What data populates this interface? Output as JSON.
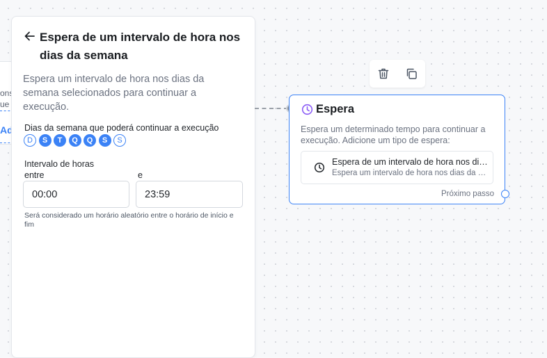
{
  "left_node": {
    "fragment_1": "ons",
    "fragment_2": "ue",
    "fragment_3": "Ad"
  },
  "panel": {
    "title": "Espera de um intervalo de hora nos dias da semana",
    "description": "Espera um intervalo de hora nos dias da semana selecionados para continuar a execução.",
    "days_label": "Dias da semana que poderá continuar a execução",
    "days": [
      {
        "label": "D",
        "selected": false
      },
      {
        "label": "S",
        "selected": true
      },
      {
        "label": "T",
        "selected": true
      },
      {
        "label": "Q",
        "selected": true
      },
      {
        "label": "Q",
        "selected": true
      },
      {
        "label": "S",
        "selected": true
      },
      {
        "label": "S",
        "selected": false
      }
    ],
    "hours_label": "Intervalo de horas",
    "from_label": "entre",
    "to_label": "e",
    "from_value": "00:00",
    "to_value": "23:59",
    "hint": "Será considerado um horário aleatório entre o horário de início e fim"
  },
  "node": {
    "title": "Espera",
    "description": "Espera um determinado tempo para continuar a execução. Adicione um tipo de espera:",
    "wait_item_title": "Espera de um intervalo de hora nos dias da semana",
    "wait_item_subtitle": "Espera um intervalo de hora nos dias da semana selecionados",
    "next_step_label": "Próximo passo"
  },
  "colors": {
    "accent": "#3b82f6",
    "node_icon": "#8b5cf6",
    "muted_text": "#6b7280"
  },
  "icons": {
    "back": "arrow-left-icon",
    "delete": "trash-icon",
    "duplicate": "copy-icon",
    "node": "clock-icon",
    "wait_item": "clock-icon"
  }
}
